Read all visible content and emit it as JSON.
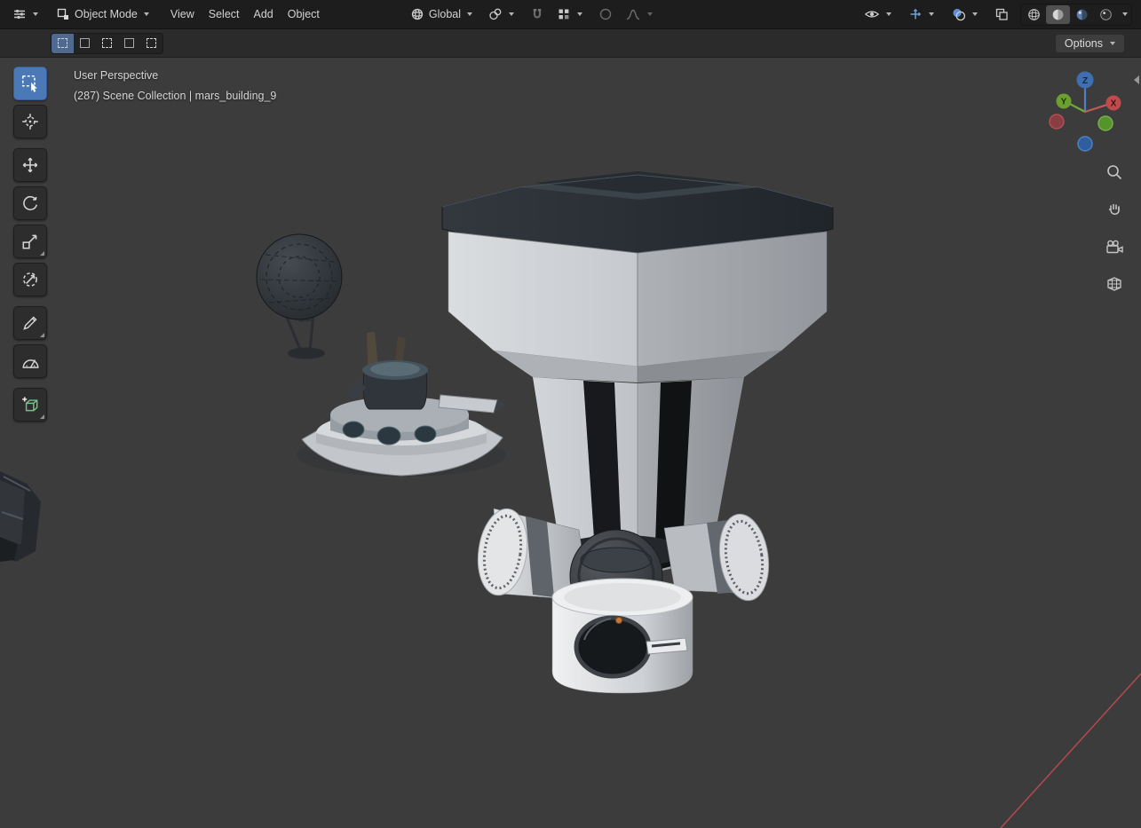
{
  "topbar": {
    "mode_label": "Object Mode",
    "menus": [
      {
        "label": "View"
      },
      {
        "label": "Select"
      },
      {
        "label": "Add"
      },
      {
        "label": "Object"
      }
    ],
    "orientation_label": "Global"
  },
  "tool_settings": {
    "options_label": "Options"
  },
  "viewport": {
    "view_label": "User Perspective",
    "collection_label": "(287) Scene Collection | mars_building_9",
    "gizmo_axes": {
      "x": "X",
      "y": "Y",
      "z": "Z"
    }
  },
  "icons": {
    "editor_type": "grid-sliders",
    "object_mode": "cube-corner",
    "global_orientation": "globe",
    "pivot_point": "rings",
    "snap": "magnet",
    "snap_target": "grid-squares",
    "proportional": "circle",
    "falloff": "bell-curve",
    "visibility": "eye",
    "gizmos": "axis-cross",
    "overlays": "spheres",
    "xray": "overlap-squares",
    "shading_wireframe": "wire-sphere",
    "shading_solid": "solid-sphere",
    "shading_material": "material-sphere",
    "shading_rendered": "rendered-sphere",
    "zoom": "magnifier",
    "pan": "hand",
    "camera_view": "camera",
    "ortho_grid": "grid"
  },
  "colors": {
    "accent": "#4b79b8",
    "header_bg": "#1d1d1d",
    "viewport_bg": "#3c3c3c",
    "axis_x": "#c04a4a",
    "axis_y": "#6ba02f",
    "axis_z": "#3f6fb0"
  }
}
